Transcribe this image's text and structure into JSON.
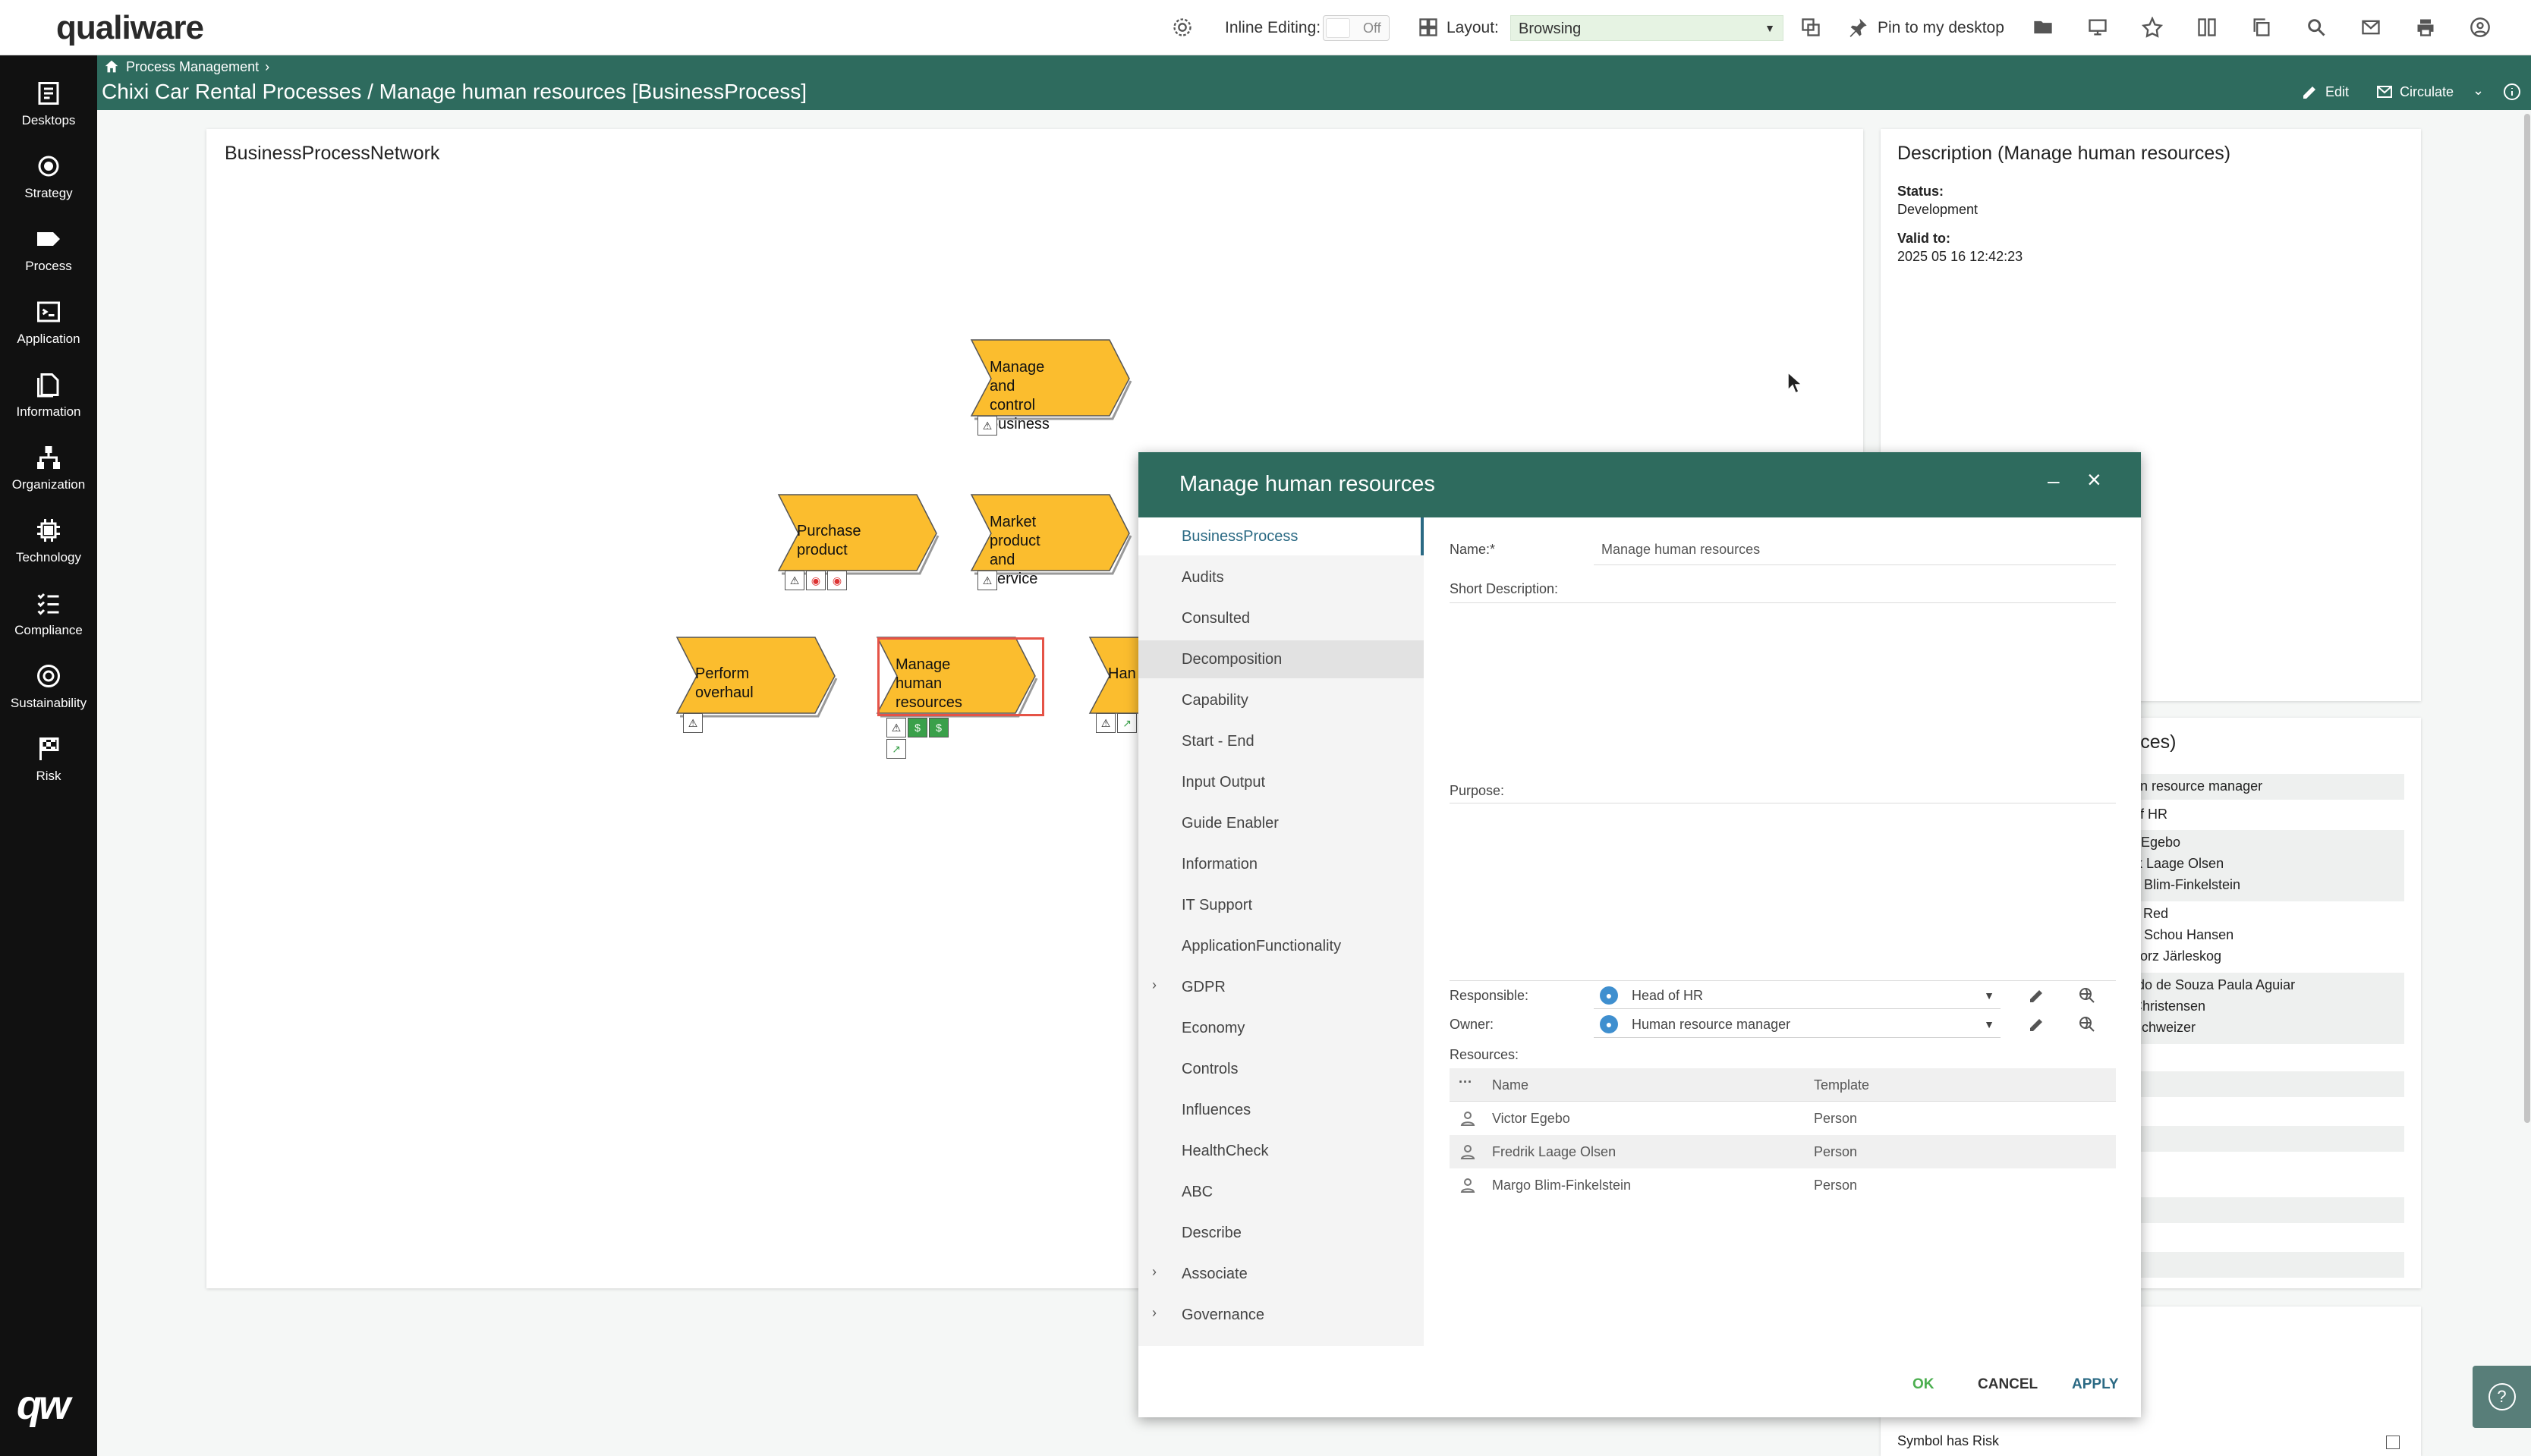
{
  "topbar": {
    "logo": "qualiware",
    "inline_editing_label": "Inline Editing:",
    "inline_editing_state": "Off",
    "layout_label": "Layout:",
    "layout_value": "Browsing",
    "pin_label": "Pin to my desktop"
  },
  "leftnav": {
    "items": [
      {
        "label": "Desktops",
        "icon": "desktop-icon"
      },
      {
        "label": "Strategy",
        "icon": "strategy-icon"
      },
      {
        "label": "Process",
        "icon": "process-icon"
      },
      {
        "label": "Application",
        "icon": "application-icon"
      },
      {
        "label": "Information",
        "icon": "information-icon"
      },
      {
        "label": "Organization",
        "icon": "organization-icon"
      },
      {
        "label": "Technology",
        "icon": "technology-icon"
      },
      {
        "label": "Compliance",
        "icon": "compliance-icon"
      },
      {
        "label": "Sustainability",
        "icon": "sustainability-icon"
      },
      {
        "label": "Risk",
        "icon": "risk-icon"
      }
    ],
    "bottom_logo": "qw"
  },
  "header": {
    "breadcrumb": "Process Management",
    "title": "Chixi Car Rental Processes / Manage human resources [BusinessProcess]",
    "edit_label": "Edit",
    "circulate_label": "Circulate"
  },
  "canvas": {
    "title": "BusinessProcessNetwork",
    "processes": [
      {
        "line1": "Manage and",
        "line2": "control business"
      },
      {
        "line1": "Purchase product",
        "line2": ""
      },
      {
        "line1": "Market product",
        "line2": "and service"
      },
      {
        "line1": "Perform overhaul",
        "line2": ""
      },
      {
        "line1": "Manage human",
        "line2": "resources"
      },
      {
        "line1": "Han",
        "line2": ""
      }
    ]
  },
  "description": {
    "title": "Description (Manage human resources)",
    "status_label": "Status:",
    "status_value": "Development",
    "valid_label": "Valid to:",
    "valid_value": "2025 05 16 12:42:23"
  },
  "resources_panel": {
    "title_fragment": "urces)",
    "rows": [
      "an resource manager",
      "of HR",
      "r Egebo",
      "ik Laage Olsen",
      "o Blim-Finkelstein",
      "lf Red",
      "n Schou Hansen",
      "gorz Järleskog",
      "rdo de Souza Paula Aguiar",
      "Christensen",
      "Schweizer"
    ]
  },
  "bottom_panel": {
    "symbol_risk_label": "Symbol has Risk"
  },
  "dialog": {
    "title": "Manage human resources",
    "nav": [
      {
        "label": "BusinessProcess",
        "chevron": ""
      },
      {
        "label": "Audits",
        "chevron": ""
      },
      {
        "label": "Consulted",
        "chevron": ""
      },
      {
        "label": "Decomposition",
        "chevron": ""
      },
      {
        "label": "Capability",
        "chevron": ""
      },
      {
        "label": "Start - End",
        "chevron": ""
      },
      {
        "label": "Input Output",
        "chevron": ""
      },
      {
        "label": "Guide Enabler",
        "chevron": ""
      },
      {
        "label": "Information",
        "chevron": ""
      },
      {
        "label": "IT Support",
        "chevron": ""
      },
      {
        "label": "ApplicationFunctionality",
        "chevron": ""
      },
      {
        "label": "GDPR",
        "chevron": "›"
      },
      {
        "label": "Economy",
        "chevron": ""
      },
      {
        "label": "Controls",
        "chevron": ""
      },
      {
        "label": "Influences",
        "chevron": ""
      },
      {
        "label": "HealthCheck",
        "chevron": ""
      },
      {
        "label": "ABC",
        "chevron": ""
      },
      {
        "label": "Describe",
        "chevron": ""
      },
      {
        "label": "Associate",
        "chevron": "›"
      },
      {
        "label": "Governance",
        "chevron": "›"
      }
    ],
    "fields": {
      "name_label": "Name:*",
      "name_value": "Manage human resources",
      "short_desc_label": "Short Description:",
      "purpose_label": "Purpose:",
      "responsible_label": "Responsible:",
      "responsible_value": "Head of HR",
      "owner_label": "Owner:",
      "owner_value": "Human resource manager",
      "resources_label": "Resources:"
    },
    "resources_table": {
      "col_menu": "···",
      "col_name": "Name",
      "col_template": "Template",
      "rows": [
        {
          "name": "Victor Egebo",
          "template": "Person"
        },
        {
          "name": "Fredrik Laage Olsen",
          "template": "Person"
        },
        {
          "name": "Margo Blim-Finkelstein",
          "template": "Person"
        }
      ]
    },
    "buttons": {
      "ok": "OK",
      "cancel": "CANCEL",
      "apply": "APPLY"
    }
  },
  "colors": {
    "header_green": "#2e6b5e",
    "process_yellow": "#fbbd2e",
    "selected_border": "#e55347",
    "active_link": "#2b6a84",
    "ok_green": "#4caf50"
  }
}
